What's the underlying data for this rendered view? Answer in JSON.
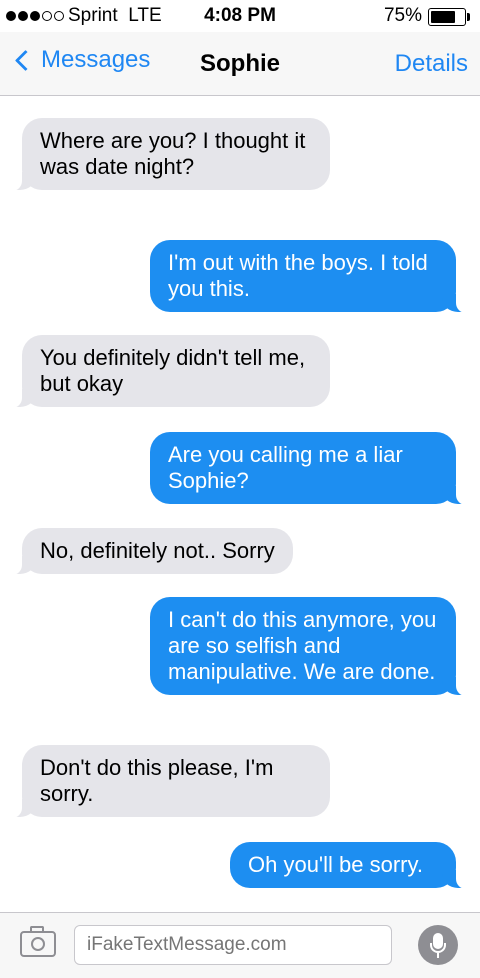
{
  "status_bar": {
    "signal_dots_filled": 3,
    "signal_dots_total": 5,
    "carrier": "Sprint",
    "network": "LTE",
    "time": "4:08 PM",
    "battery_text": "75%",
    "battery_level": 0.75
  },
  "nav": {
    "back_label": "Messages",
    "title": "Sophie",
    "details_label": "Details"
  },
  "messages": [
    {
      "direction": "incoming",
      "text": "Where are you? I thought it was date night?"
    },
    {
      "direction": "outgoing",
      "text": "I'm out with the boys. I told you this."
    },
    {
      "direction": "incoming",
      "text": "You definitely didn't tell me, but okay"
    },
    {
      "direction": "outgoing",
      "text": "Are you calling me a liar Sophie?"
    },
    {
      "direction": "incoming",
      "text": "No, definitely not.. Sorry"
    },
    {
      "direction": "outgoing",
      "text": "I can't do this anymore, you are so selfish and manipulative. We are done."
    },
    {
      "direction": "incoming",
      "text": "Don't do this please, I'm sorry."
    },
    {
      "direction": "outgoing",
      "text": "Oh you'll be sorry."
    }
  ],
  "input_bar": {
    "placeholder": "iFakeTextMessage.com",
    "camera_icon": "camera-icon",
    "mic_icon": "microphone-icon"
  },
  "colors": {
    "accent": "#1f87f3",
    "outgoing_bubble": "#1d8ef1",
    "incoming_bubble": "#e5e5ea"
  }
}
